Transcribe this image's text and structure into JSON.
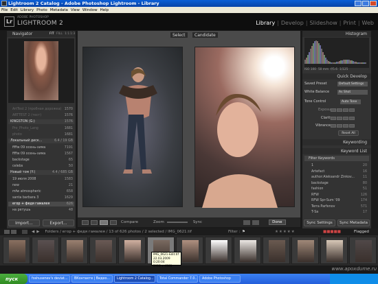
{
  "window": {
    "title": "Lightroom 2 Catalog - Adobe Photoshop Lightroom - Library"
  },
  "menu": [
    "File",
    "Edit",
    "Library",
    "Photo",
    "Metadata",
    "View",
    "Window",
    "Help"
  ],
  "identity": {
    "badge": "Lr",
    "subtitle": "ADOBE PHOTOSHOP",
    "title": "LIGHTROOM 2"
  },
  "modules": [
    "Library",
    "Develop",
    "Slideshow",
    "Print",
    "Web"
  ],
  "left": {
    "navigator": "Navigator",
    "zoom": [
      "FIT",
      "FILL",
      "1:1",
      "1:3"
    ],
    "rows": [
      {
        "label": "ArtTest 2 (пробная дорожка)",
        "count": "1570",
        "dim": true
      },
      {
        "label": "ARTTEST 2 (тест)",
        "count": "1576",
        "dim": true
      },
      {
        "label": "KINGSTON (G:)",
        "count": "1576",
        "section": true
      },
      {
        "label": "Pro_Photo_Lang",
        "count": "1681",
        "dim": true
      },
      {
        "label": "photo",
        "count": "1681",
        "dim": true
      },
      {
        "label": "Локальный диск...",
        "count": "6.4 / 19 GB",
        "section": true
      },
      {
        "label": "ffffw 09 осень-зима",
        "count": "7191"
      },
      {
        "label": "ffffw 09 осень-зима",
        "count": "1567"
      },
      {
        "label": "backstage",
        "count": "65"
      },
      {
        "label": "celebs",
        "count": "50"
      },
      {
        "label": "Новый том (Y:)",
        "count": "4.4 / 685 GB",
        "section": true
      },
      {
        "label": "19 июля 2008",
        "count": "1583"
      },
      {
        "label": "new",
        "count": "21"
      },
      {
        "label": "mfw atmospheric",
        "count": "658"
      },
      {
        "label": "santa barbara 3",
        "count": "1629"
      },
      {
        "label": "егор + федя гамалея",
        "count": "626",
        "selected": true
      },
      {
        "label": "на ретушь",
        "count": "48"
      }
    ],
    "import_label": "Import...",
    "export_label": "Export..."
  },
  "center": {
    "select_label": "Select",
    "candidate_label": "Candidate",
    "compare_label": "Compare",
    "zoom_label": "Zoom",
    "sync_label": "Sync",
    "done_label": "Done"
  },
  "right": {
    "histogram": "Histogram",
    "histo_meta": [
      "ISO 100",
      "50 mm",
      "f/5.6",
      "1/125"
    ],
    "quick_develop": "Quick Develop",
    "saved_preset": {
      "label": "Saved Preset",
      "value": "Default Settings"
    },
    "white_balance": {
      "label": "White Balance",
      "value": "As Shot"
    },
    "tone_control": {
      "label": "Tone Control",
      "value": "Auto Tone"
    },
    "adjust_rows": [
      "Exposure",
      "Clarity",
      "Vibrance"
    ],
    "reset_label": "Reset All",
    "keywording": "Keywording",
    "keyword_list": "Keyword List",
    "filter_keywords": "Filter Keywords",
    "keywords": [
      {
        "label": "1",
        "count": "20"
      },
      {
        "label": "Artefact",
        "count": "16"
      },
      {
        "label": "author:Aleksandr Zinkov...",
        "count": "11"
      },
      {
        "label": "backstage",
        "count": "80"
      },
      {
        "label": "fashion",
        "count": "51"
      },
      {
        "label": "RFW",
        "count": "126"
      },
      {
        "label": "RFW Spr-Sum '09",
        "count": "174"
      },
      {
        "label": "Terra Parfenov",
        "count": "571"
      },
      {
        "label": "T-Sa",
        "count": "17"
      }
    ],
    "sync_settings": "Sync Settings",
    "sync_metadata": "Sync Metadata"
  },
  "filmstrip": {
    "breadcrumb": "Folders / егор + федя гамалея / 13 of 626 photos / 2 selected / IMG_0621.tif",
    "filter_label": "Filter :",
    "flagged_label": "Flagged",
    "tooltip": [
      "IMG_0621-Edit.tif",
      "22.03.2009 0:20:04",
      "2912 x 4368"
    ]
  },
  "taskbar": {
    "start": "пуск",
    "tasks": [
      "foshusenev's deviat...",
      "ВКонтакте | Видео...",
      "Lightroom 2 Catalog...",
      "Total Commander 7.0...",
      "Adobe Photoshop"
    ],
    "active_index": 2
  },
  "watermark": "www.apoxdume.ru"
}
